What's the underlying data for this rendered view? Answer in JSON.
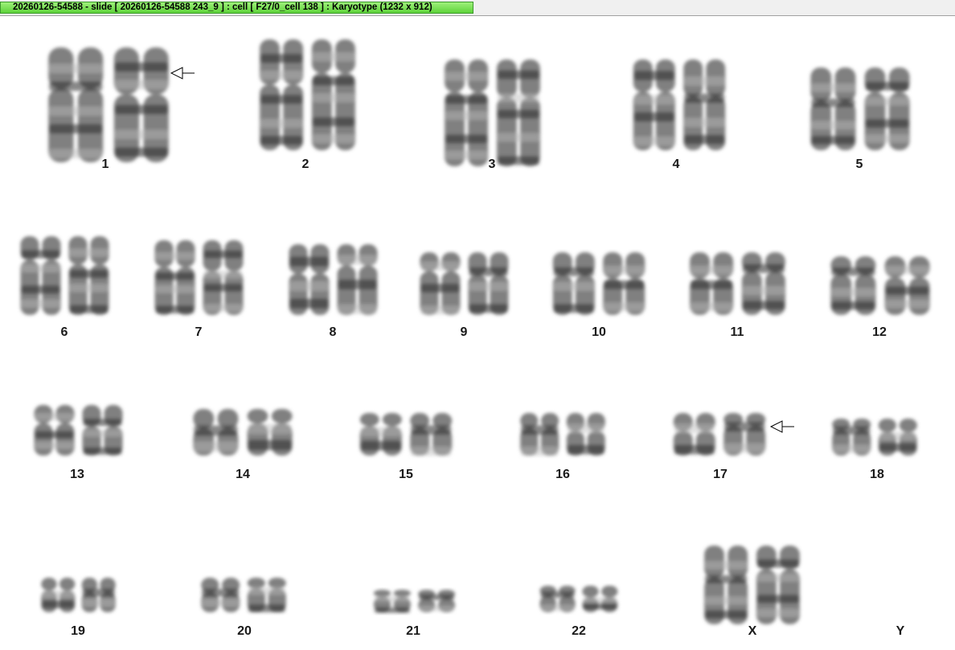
{
  "window": {
    "title": "20260126-54588 - slide [ 20260126-54588 243_9 ] : cell [ F27/0_cell 138 ] : Karyotype  (1232 x 912)"
  },
  "karyotype": {
    "chromosomes": [
      {
        "id": "1",
        "label": "1",
        "marked": true
      },
      {
        "id": "2",
        "label": "2",
        "marked": false
      },
      {
        "id": "3",
        "label": "3",
        "marked": false
      },
      {
        "id": "4",
        "label": "4",
        "marked": false
      },
      {
        "id": "5",
        "label": "5",
        "marked": false
      },
      {
        "id": "6",
        "label": "6",
        "marked": false
      },
      {
        "id": "7",
        "label": "7",
        "marked": false
      },
      {
        "id": "8",
        "label": "8",
        "marked": false
      },
      {
        "id": "9",
        "label": "9",
        "marked": false
      },
      {
        "id": "10",
        "label": "10",
        "marked": false
      },
      {
        "id": "11",
        "label": "11",
        "marked": false
      },
      {
        "id": "12",
        "label": "12",
        "marked": false
      },
      {
        "id": "13",
        "label": "13",
        "marked": false
      },
      {
        "id": "14",
        "label": "14",
        "marked": false
      },
      {
        "id": "15",
        "label": "15",
        "marked": false
      },
      {
        "id": "16",
        "label": "16",
        "marked": false
      },
      {
        "id": "17",
        "label": "17",
        "marked": true
      },
      {
        "id": "18",
        "label": "18",
        "marked": false
      },
      {
        "id": "19",
        "label": "19",
        "marked": false
      },
      {
        "id": "20",
        "label": "20",
        "marked": false
      },
      {
        "id": "21",
        "label": "21",
        "marked": false
      },
      {
        "id": "22",
        "label": "22",
        "marked": false
      },
      {
        "id": "X",
        "label": "X",
        "marked": false
      },
      {
        "id": "Y",
        "label": "Y",
        "marked": false
      }
    ],
    "icons": {
      "marker": "arrow-left-icon"
    },
    "colors": {
      "title_bar": "#5ed33a",
      "chromosome": "#5a5a5a"
    }
  }
}
